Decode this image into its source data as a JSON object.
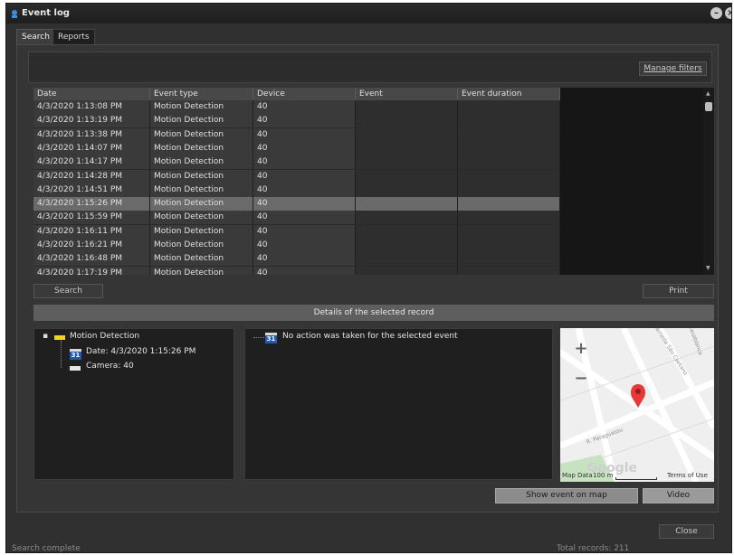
{
  "window": {
    "title": "Event log"
  },
  "tabs": [
    {
      "label": "Search"
    },
    {
      "label": "Reports"
    }
  ],
  "filters": {
    "manage_label": "Manage filters"
  },
  "table": {
    "columns": [
      "Date",
      "Event type",
      "Device",
      "Event",
      "Event duration"
    ],
    "rows": [
      [
        "4/3/2020 1:13:08 PM",
        "Motion Detection",
        "40",
        "",
        ""
      ],
      [
        "4/3/2020 1:13:19 PM",
        "Motion Detection",
        "40",
        "",
        ""
      ],
      [
        "4/3/2020 1:13:38 PM",
        "Motion Detection",
        "40",
        "",
        ""
      ],
      [
        "4/3/2020 1:14:07 PM",
        "Motion Detection",
        "40",
        "",
        ""
      ],
      [
        "4/3/2020 1:14:17 PM",
        "Motion Detection",
        "40",
        "",
        ""
      ],
      [
        "4/3/2020 1:14:28 PM",
        "Motion Detection",
        "40",
        "",
        ""
      ],
      [
        "4/3/2020 1:14:51 PM",
        "Motion Detection",
        "40",
        "",
        ""
      ],
      [
        "4/3/2020 1:15:26 PM",
        "Motion Detection",
        "40",
        "",
        ""
      ],
      [
        "4/3/2020 1:15:59 PM",
        "Motion Detection",
        "40",
        "",
        ""
      ],
      [
        "4/3/2020 1:16:11 PM",
        "Motion Detection",
        "40",
        "",
        ""
      ],
      [
        "4/3/2020 1:16:21 PM",
        "Motion Detection",
        "40",
        "",
        ""
      ],
      [
        "4/3/2020 1:16:48 PM",
        "Motion Detection",
        "40",
        "",
        ""
      ],
      [
        "4/3/2020 1:17:19 PM",
        "Motion Detection",
        "40",
        "",
        ""
      ]
    ],
    "selected_row": 7
  },
  "buttons": {
    "search": "Search",
    "print": "Print",
    "show_on_map": "Show event on map",
    "video": "Video",
    "close": "Close"
  },
  "details": {
    "header": "Details of the selected record",
    "tree": {
      "root": "Motion Detection",
      "date": "Date: 4/3/2020 1:15:26 PM",
      "camera": "Camera: 40",
      "calendar_day": "31"
    },
    "actions": {
      "text": "No action was taken for the selected event"
    }
  },
  "map": {
    "streets": [
      "Alameda São Caetano",
      "R. Paraguassu",
      "Casablanca"
    ],
    "footer_left": "Map Data",
    "footer_scale": "100 m",
    "footer_right": "Terms of Use",
    "watermark": "Google",
    "zoom_in": "+",
    "zoom_out": "−"
  },
  "status": {
    "left": "Search complete",
    "right": "Total records: 211"
  },
  "colors": {
    "window_bg": "#303030",
    "selected_row": "#6a6a6a",
    "pin": "#e53935"
  }
}
